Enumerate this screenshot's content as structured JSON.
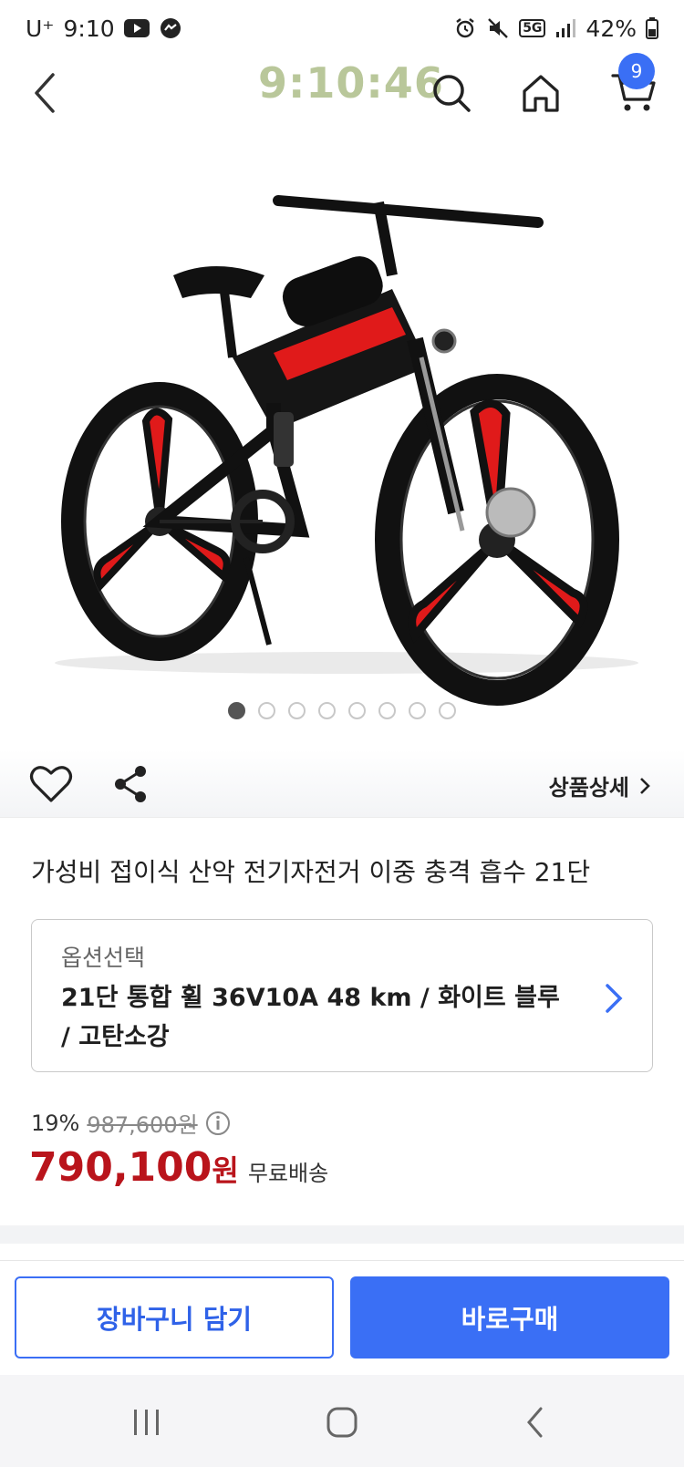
{
  "status_bar": {
    "carrier": "U⁺",
    "time": "9:10",
    "network": "5G",
    "battery": "42%"
  },
  "header": {
    "clock_overlay": "9:10:46",
    "cart_count": "9"
  },
  "gallery": {
    "image_count": 8,
    "active_index": 0
  },
  "actions": {
    "detail_label": "상품상세"
  },
  "product": {
    "title": "가성비 접이식 산악 전기자전거 이중 충격 흡수 21단"
  },
  "option": {
    "label": "옵션선택",
    "value": "21단 통합 휠 36V10A 48 km / 화이트 블루 / 고탄소강"
  },
  "price": {
    "discount": "19%",
    "original": "987,600원",
    "sale_number": "790,100",
    "sale_unit": "원",
    "shipping": "무료배송"
  },
  "buttons": {
    "add_to_cart": "장바구니 담기",
    "buy_now": "바로구매"
  },
  "colors": {
    "accent": "#3a6ff5",
    "sale_red": "#b9141b"
  }
}
